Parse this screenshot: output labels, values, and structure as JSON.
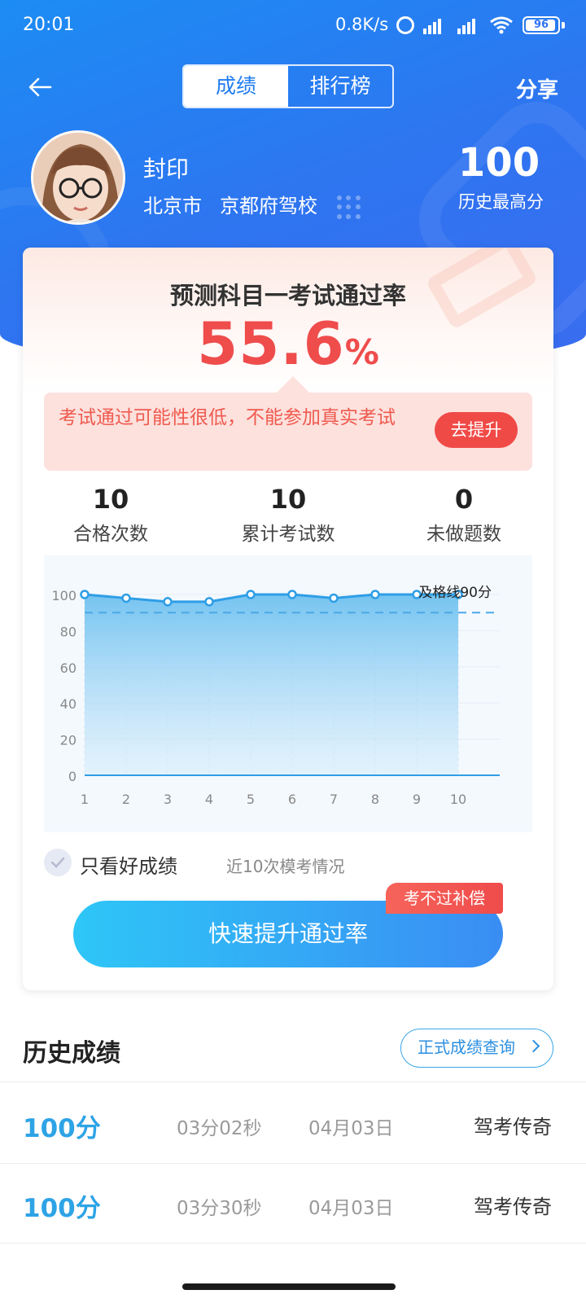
{
  "status_bar": {
    "time": "20:01",
    "speed": "0.8K/s",
    "signal1": "HD",
    "signal2": "HD",
    "battery": "96"
  },
  "header": {
    "tabs": [
      {
        "label": "成绩",
        "active": true
      },
      {
        "label": "排行榜",
        "active": false
      }
    ],
    "share_label": "分享"
  },
  "profile": {
    "name": "封印",
    "location": "北京市",
    "school": "京都府驾校",
    "best_score": "100",
    "best_label": "历史最高分"
  },
  "prediction": {
    "title": "预测科目一考试通过率",
    "rate": "55.6",
    "rate_unit": "%",
    "warning": "考试通过可能性很低，不能参加真实考试",
    "improve_button": "去提升"
  },
  "stats": [
    {
      "value": "10",
      "label": "合格次数"
    },
    {
      "value": "10",
      "label": "累计考试数"
    },
    {
      "value": "0",
      "label": "未做题数"
    }
  ],
  "chart_data": {
    "type": "area",
    "x": [
      1,
      2,
      3,
      4,
      5,
      6,
      7,
      8,
      9,
      10
    ],
    "series": [
      {
        "values": [
          100,
          98,
          96,
          96,
          100,
          100,
          98,
          100,
          100,
          100
        ]
      }
    ],
    "yticks": [
      0,
      20,
      40,
      60,
      80,
      100
    ],
    "ylim": [
      0,
      100
    ],
    "pass_line": {
      "value": 90,
      "label": "及格线90分"
    },
    "line_color": "#2e9ee6",
    "pass_color": "#4aa8e8"
  },
  "filter": {
    "label": "只看好成绩",
    "note": "近10次模考情况",
    "checked": true
  },
  "cta": {
    "label": "快速提升通过率",
    "badge": "考不过补偿"
  },
  "history": {
    "title": "历史成绩",
    "query_button": "正式成绩查询",
    "rows": [
      {
        "score": "100分",
        "duration": "03分02秒",
        "date": "04月03日",
        "source": "驾考传奇"
      },
      {
        "score": "100分",
        "duration": "03分30秒",
        "date": "04月03日",
        "source": "驾考传奇"
      }
    ]
  }
}
